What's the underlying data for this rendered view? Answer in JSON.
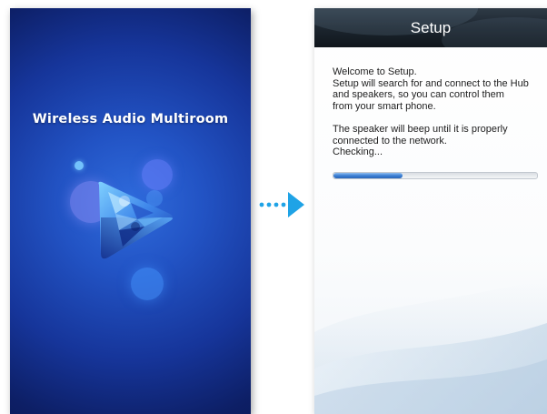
{
  "splash": {
    "app_title": "Wireless Audio Multiroom",
    "logo_icon": "play-logo-icon"
  },
  "transition": {
    "icon": "dotted-arrow-right-icon",
    "color": "#1fa3e6"
  },
  "setup": {
    "header_title": "Setup",
    "welcome_line": "Welcome to Setup.",
    "desc_line1": "Setup will search for and connect to the Hub",
    "desc_line2": "and speakers, so you can control them",
    "desc_line3": "from your smart phone.",
    "beep_line1": "The speaker will beep until it is properly",
    "beep_line2": "connected to the network.",
    "status_text": "Checking...",
    "progress_fraction": 0.34
  },
  "colors": {
    "splash_bg": "#1a3ea8",
    "header_bg": "#1b242d",
    "progress": "#3b7fd4"
  }
}
